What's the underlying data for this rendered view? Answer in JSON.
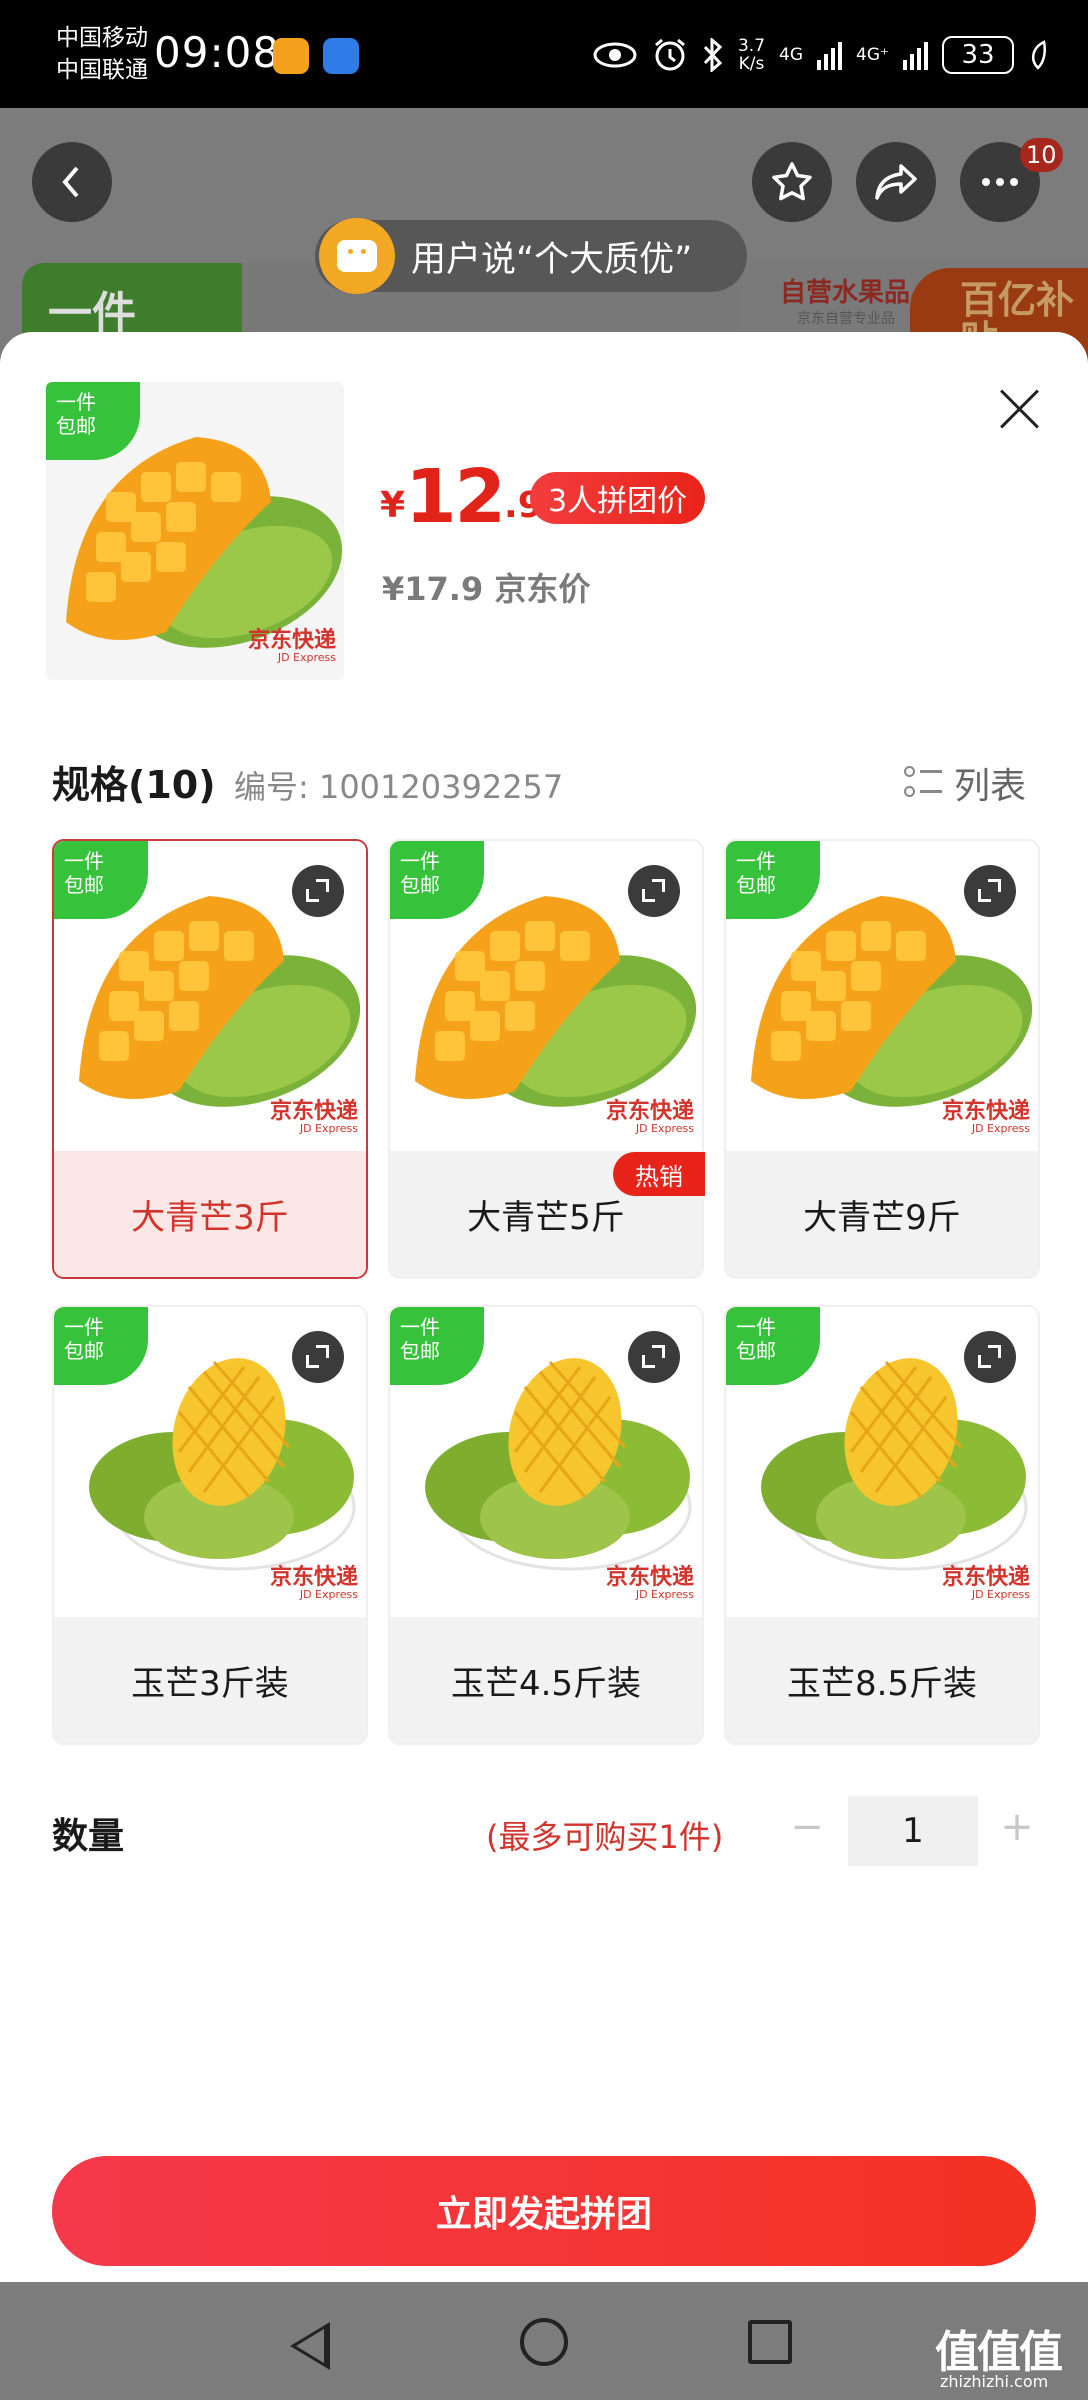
{
  "status_bar": {
    "carrier_1": "中国移动",
    "carrier_2": "中国联通",
    "time": "09:08",
    "speed_value": "3.7",
    "speed_unit": "K/s",
    "net_1": "4G",
    "net_2": "4G⁺",
    "battery": "33",
    "icons": [
      "eye-icon",
      "alarm-icon",
      "bluetooth-icon",
      "signal-icon",
      "leaf-icon"
    ]
  },
  "background_page": {
    "cart_count": "10",
    "review_pill": "用户说“个大质优”",
    "banner_left": "一件",
    "store_name": "自营水果品",
    "store_sub": "京东自营专业品",
    "subsidy": "百亿补贴"
  },
  "product": {
    "currency": "¥",
    "price_int": "12",
    "price_dec": ".9",
    "group_tag": "3人拼团价",
    "jd_price": "¥17.9 京东价",
    "ship_tag_line1": "一件",
    "ship_tag_line2": "包邮",
    "brand_mark": "京东快递",
    "brand_mark_en": "JD Express"
  },
  "spec": {
    "title": "规格(10)",
    "code": "编号: 100120392257",
    "list_label": "列表",
    "hot_tag": "热销",
    "options": [
      {
        "label": "大青芒3斤",
        "selected": true
      },
      {
        "label": "大青芒5斤",
        "selected": false
      },
      {
        "label": "大青芒9斤",
        "selected": false
      },
      {
        "label": "玉芒3斤装",
        "selected": false
      },
      {
        "label": "玉芒4.5斤装",
        "selected": false
      },
      {
        "label": "玉芒8.5斤装",
        "selected": false
      }
    ]
  },
  "quantity": {
    "label": "数量",
    "limit": "(最多可购买1件)",
    "minus": "−",
    "value": "1",
    "plus": "+"
  },
  "cta": {
    "label": "立即发起拼团"
  },
  "watermark": {
    "text": "值值值",
    "sub": "zhizhizhi.com"
  },
  "colors": {
    "accent_red": "#e2231a",
    "ship_green": "#36c23a",
    "selected_bg": "#fbe8e6"
  }
}
